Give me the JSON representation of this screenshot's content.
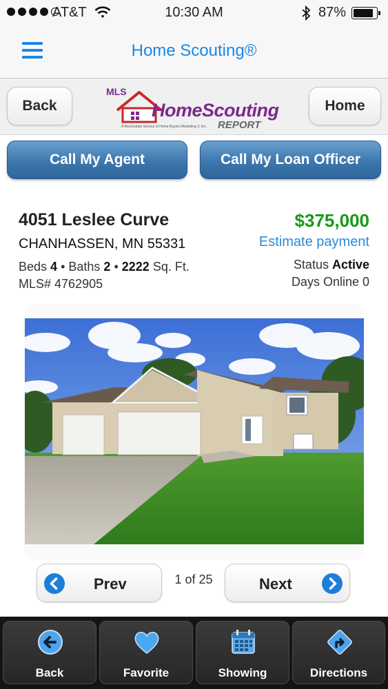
{
  "status_bar": {
    "carrier": "AT&T",
    "time": "10:30 AM",
    "battery": "87%",
    "battery_level": 0.87
  },
  "nav": {
    "title": "Home Scouting®"
  },
  "header": {
    "back_label": "Back",
    "home_label": "Home",
    "logo": {
      "mls": "MLS",
      "brand": "HomeScouting",
      "report": "REPORT",
      "tagline": "A Real Estate Service of Home Buyers Marketing II, Inc."
    }
  },
  "actions": {
    "call_agent": "Call My Agent",
    "call_loan_officer": "Call My Loan Officer"
  },
  "listing": {
    "address": "4051 Leslee Curve",
    "city": "CHANHASSEN, MN 55331",
    "beds_label": "Beds",
    "beds": "4",
    "baths_label": "Baths",
    "baths": "2",
    "sqft": "2222",
    "sqft_label": "Sq. Ft.",
    "mls": "MLS# 4762905",
    "price": "$375,000",
    "estimate_payment": "Estimate payment",
    "status_label": "Status",
    "status": "Active",
    "days_online": "Days Online 0"
  },
  "pager": {
    "prev": "Prev",
    "next": "Next",
    "count": "1 of 25"
  },
  "tab_bar": {
    "back": "Back",
    "favorite": "Favorite",
    "showing": "Showing",
    "directions": "Directions"
  },
  "colors": {
    "accent_blue": "#1b87e6",
    "price_green": "#169a16",
    "call_button": "#3d77ad",
    "logo_purple": "#7a2a8c",
    "logo_red": "#c62828"
  }
}
